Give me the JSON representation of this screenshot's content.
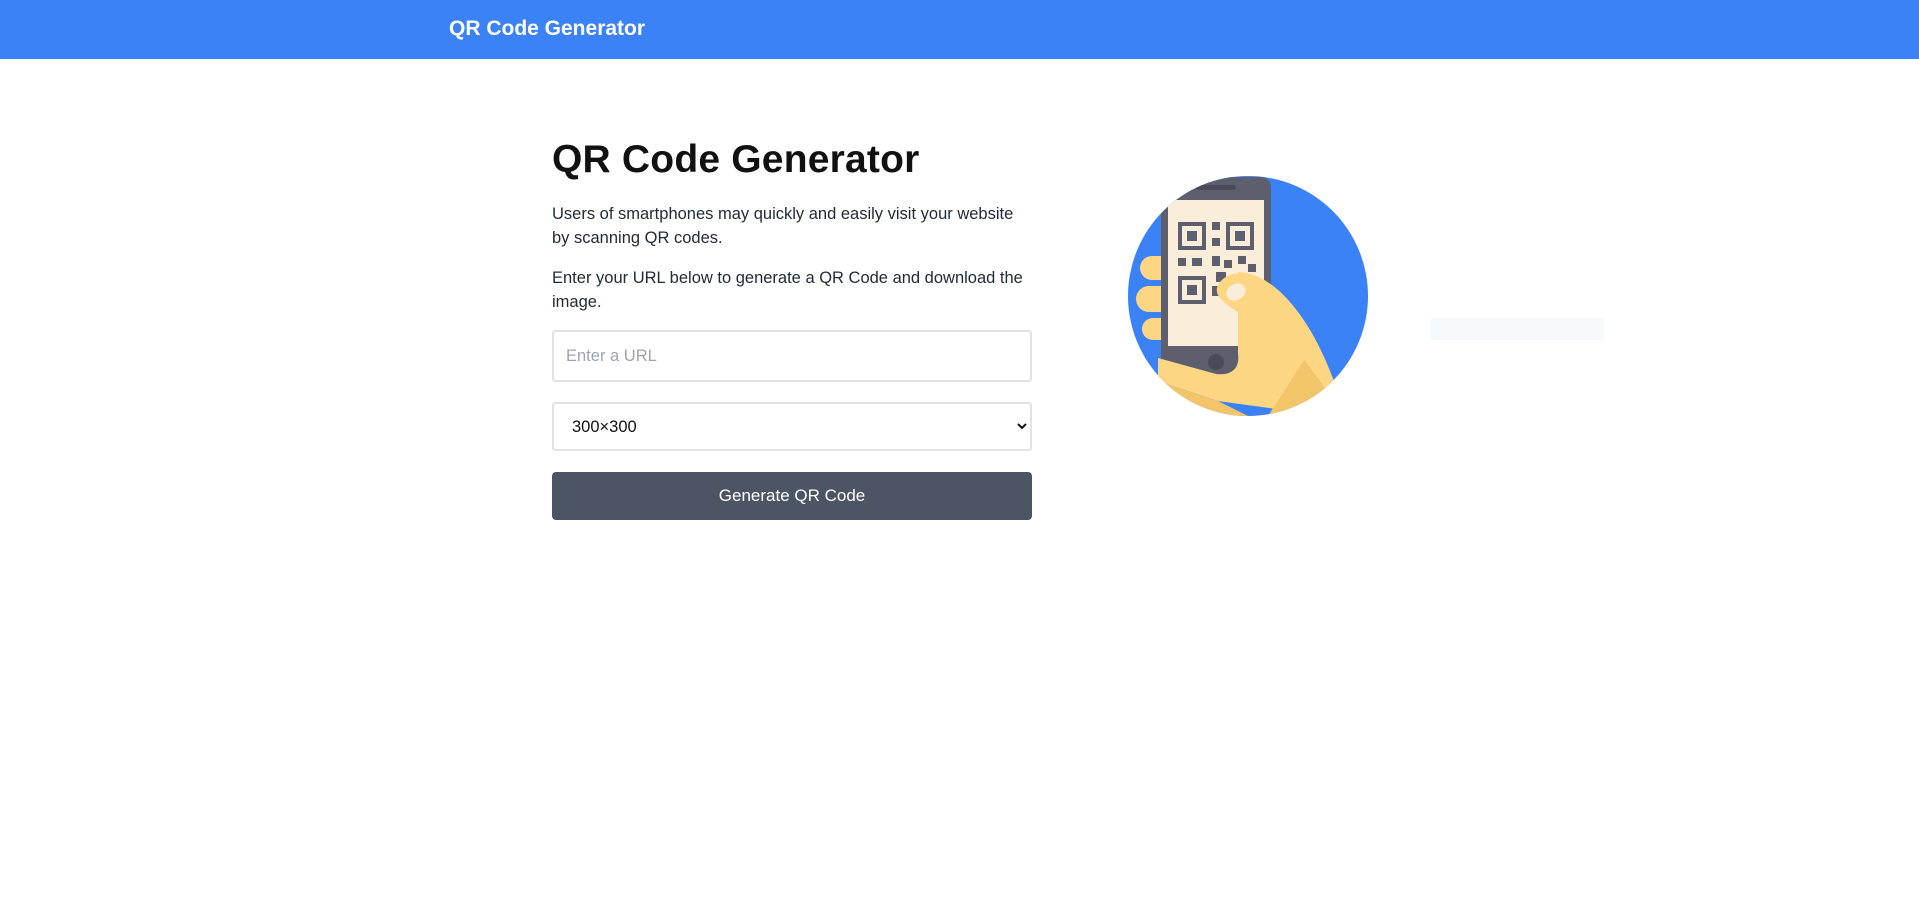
{
  "navbar": {
    "brand": "QR Code Generator",
    "color": "#3b82f6"
  },
  "main": {
    "title": "QR Code Generator",
    "description": "Users of smartphones may quickly and easily visit your website by scanning QR codes.",
    "instructions": "Enter your URL below to generate a QR Code and download the image.",
    "url_input": {
      "value": "",
      "placeholder": "Enter a URL"
    },
    "size_select": {
      "selected": "300×300"
    },
    "generate_button": {
      "label": "Generate QR Code",
      "color": "#4b5563"
    }
  },
  "illustration": {
    "icon": "phone-scanning-qr-icon",
    "circle_color": "#3b82f6"
  }
}
